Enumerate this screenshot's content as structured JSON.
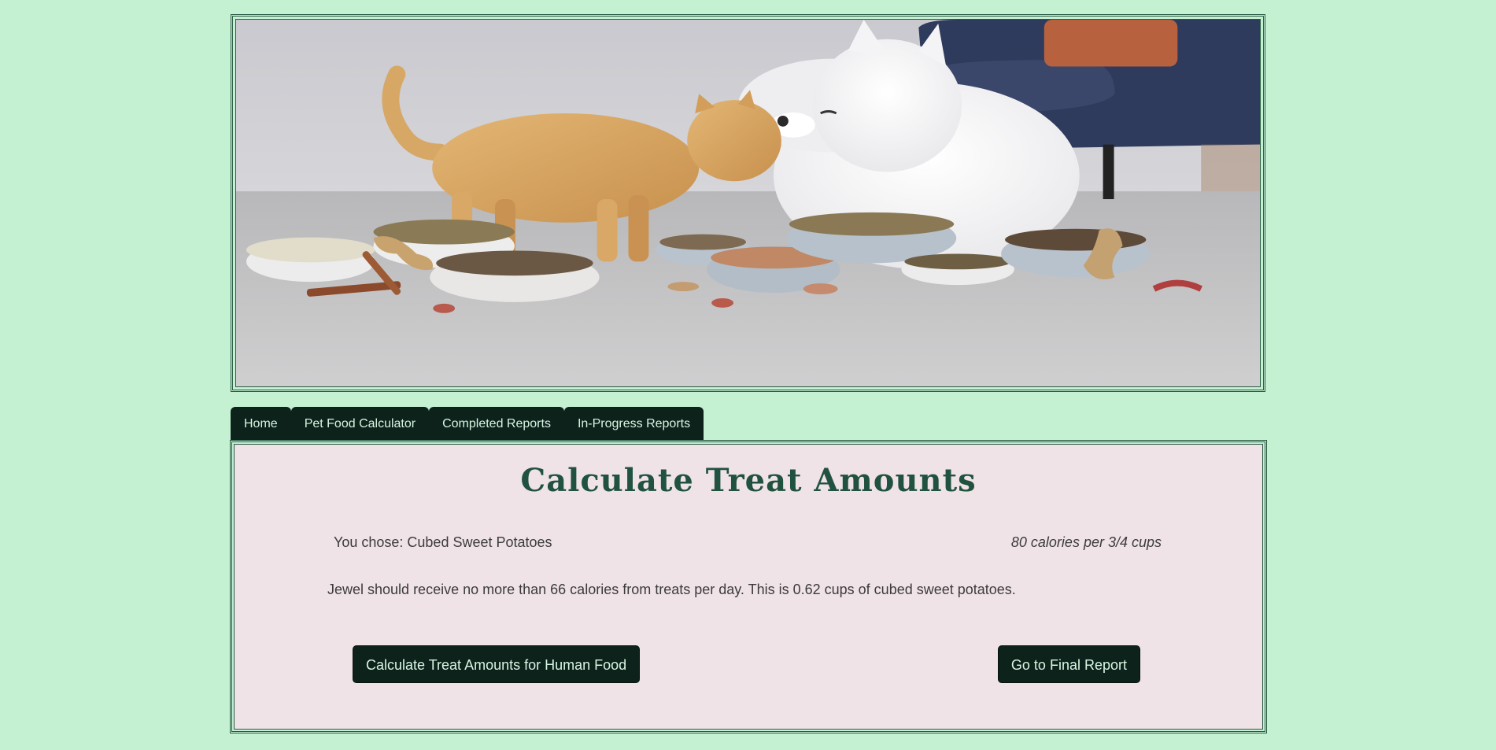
{
  "hero": {
    "image_description": "cat-and-dog-with-food-bowls"
  },
  "nav": {
    "tabs": [
      {
        "label": "Home"
      },
      {
        "label": "Pet Food Calculator"
      },
      {
        "label": "Completed Reports"
      },
      {
        "label": "In-Progress Reports"
      }
    ]
  },
  "main": {
    "title": "Calculate Treat Amounts",
    "choice_text": "You chose: Cubed Sweet Potatoes",
    "calories_text": "80 calories per 3/4 cups",
    "advice_text": "Jewel should receive no more than 66 calories from treats per day. This is 0.62 cups of cubed sweet potatoes.",
    "human_food_button": "Calculate Treat Amounts for Human Food",
    "final_report_button": "Go to Final Report"
  },
  "colors": {
    "page_background": "#c5f1d3",
    "panel_background": "#f0e3e7",
    "dark_green": "#0c221b",
    "title_green": "#21523f"
  }
}
